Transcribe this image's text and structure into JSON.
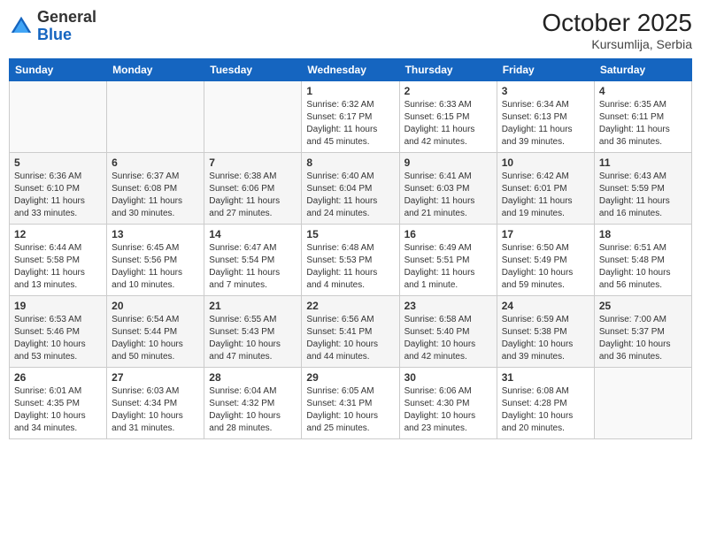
{
  "header": {
    "logo_general": "General",
    "logo_blue": "Blue",
    "month": "October 2025",
    "location": "Kursumlija, Serbia"
  },
  "days_of_week": [
    "Sunday",
    "Monday",
    "Tuesday",
    "Wednesday",
    "Thursday",
    "Friday",
    "Saturday"
  ],
  "weeks": [
    [
      {
        "day": "",
        "info": ""
      },
      {
        "day": "",
        "info": ""
      },
      {
        "day": "",
        "info": ""
      },
      {
        "day": "1",
        "info": "Sunrise: 6:32 AM\nSunset: 6:17 PM\nDaylight: 11 hours\nand 45 minutes."
      },
      {
        "day": "2",
        "info": "Sunrise: 6:33 AM\nSunset: 6:15 PM\nDaylight: 11 hours\nand 42 minutes."
      },
      {
        "day": "3",
        "info": "Sunrise: 6:34 AM\nSunset: 6:13 PM\nDaylight: 11 hours\nand 39 minutes."
      },
      {
        "day": "4",
        "info": "Sunrise: 6:35 AM\nSunset: 6:11 PM\nDaylight: 11 hours\nand 36 minutes."
      }
    ],
    [
      {
        "day": "5",
        "info": "Sunrise: 6:36 AM\nSunset: 6:10 PM\nDaylight: 11 hours\nand 33 minutes."
      },
      {
        "day": "6",
        "info": "Sunrise: 6:37 AM\nSunset: 6:08 PM\nDaylight: 11 hours\nand 30 minutes."
      },
      {
        "day": "7",
        "info": "Sunrise: 6:38 AM\nSunset: 6:06 PM\nDaylight: 11 hours\nand 27 minutes."
      },
      {
        "day": "8",
        "info": "Sunrise: 6:40 AM\nSunset: 6:04 PM\nDaylight: 11 hours\nand 24 minutes."
      },
      {
        "day": "9",
        "info": "Sunrise: 6:41 AM\nSunset: 6:03 PM\nDaylight: 11 hours\nand 21 minutes."
      },
      {
        "day": "10",
        "info": "Sunrise: 6:42 AM\nSunset: 6:01 PM\nDaylight: 11 hours\nand 19 minutes."
      },
      {
        "day": "11",
        "info": "Sunrise: 6:43 AM\nSunset: 5:59 PM\nDaylight: 11 hours\nand 16 minutes."
      }
    ],
    [
      {
        "day": "12",
        "info": "Sunrise: 6:44 AM\nSunset: 5:58 PM\nDaylight: 11 hours\nand 13 minutes."
      },
      {
        "day": "13",
        "info": "Sunrise: 6:45 AM\nSunset: 5:56 PM\nDaylight: 11 hours\nand 10 minutes."
      },
      {
        "day": "14",
        "info": "Sunrise: 6:47 AM\nSunset: 5:54 PM\nDaylight: 11 hours\nand 7 minutes."
      },
      {
        "day": "15",
        "info": "Sunrise: 6:48 AM\nSunset: 5:53 PM\nDaylight: 11 hours\nand 4 minutes."
      },
      {
        "day": "16",
        "info": "Sunrise: 6:49 AM\nSunset: 5:51 PM\nDaylight: 11 hours\nand 1 minute."
      },
      {
        "day": "17",
        "info": "Sunrise: 6:50 AM\nSunset: 5:49 PM\nDaylight: 10 hours\nand 59 minutes."
      },
      {
        "day": "18",
        "info": "Sunrise: 6:51 AM\nSunset: 5:48 PM\nDaylight: 10 hours\nand 56 minutes."
      }
    ],
    [
      {
        "day": "19",
        "info": "Sunrise: 6:53 AM\nSunset: 5:46 PM\nDaylight: 10 hours\nand 53 minutes."
      },
      {
        "day": "20",
        "info": "Sunrise: 6:54 AM\nSunset: 5:44 PM\nDaylight: 10 hours\nand 50 minutes."
      },
      {
        "day": "21",
        "info": "Sunrise: 6:55 AM\nSunset: 5:43 PM\nDaylight: 10 hours\nand 47 minutes."
      },
      {
        "day": "22",
        "info": "Sunrise: 6:56 AM\nSunset: 5:41 PM\nDaylight: 10 hours\nand 44 minutes."
      },
      {
        "day": "23",
        "info": "Sunrise: 6:58 AM\nSunset: 5:40 PM\nDaylight: 10 hours\nand 42 minutes."
      },
      {
        "day": "24",
        "info": "Sunrise: 6:59 AM\nSunset: 5:38 PM\nDaylight: 10 hours\nand 39 minutes."
      },
      {
        "day": "25",
        "info": "Sunrise: 7:00 AM\nSunset: 5:37 PM\nDaylight: 10 hours\nand 36 minutes."
      }
    ],
    [
      {
        "day": "26",
        "info": "Sunrise: 6:01 AM\nSunset: 4:35 PM\nDaylight: 10 hours\nand 34 minutes."
      },
      {
        "day": "27",
        "info": "Sunrise: 6:03 AM\nSunset: 4:34 PM\nDaylight: 10 hours\nand 31 minutes."
      },
      {
        "day": "28",
        "info": "Sunrise: 6:04 AM\nSunset: 4:32 PM\nDaylight: 10 hours\nand 28 minutes."
      },
      {
        "day": "29",
        "info": "Sunrise: 6:05 AM\nSunset: 4:31 PM\nDaylight: 10 hours\nand 25 minutes."
      },
      {
        "day": "30",
        "info": "Sunrise: 6:06 AM\nSunset: 4:30 PM\nDaylight: 10 hours\nand 23 minutes."
      },
      {
        "day": "31",
        "info": "Sunrise: 6:08 AM\nSunset: 4:28 PM\nDaylight: 10 hours\nand 20 minutes."
      },
      {
        "day": "",
        "info": ""
      }
    ]
  ]
}
